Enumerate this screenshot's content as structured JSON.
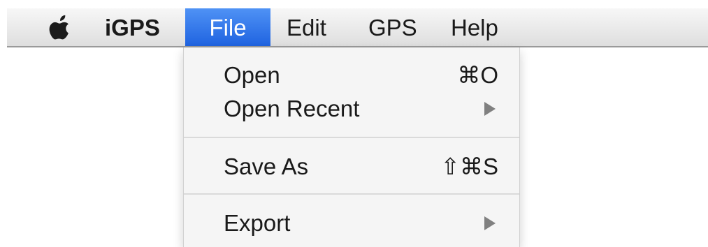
{
  "menubar": {
    "apple_icon": "apple-icon",
    "items": [
      {
        "label": "iGPS"
      },
      {
        "label": "File"
      },
      {
        "label": "Edit"
      },
      {
        "label": "GPS"
      },
      {
        "label": "Help"
      }
    ],
    "active_item": "File"
  },
  "file_menu": {
    "items": [
      {
        "label": "Open",
        "shortcut": "⌘O"
      },
      {
        "label": "Open Recent",
        "submenu_icon": "chevron-right-icon"
      },
      {
        "label": "Save As",
        "shortcut": "⇧⌘S"
      },
      {
        "label": "Export",
        "submenu_icon": "chevron-right-icon"
      }
    ]
  },
  "colors": {
    "active_menu": "#2b6de6",
    "menubar": "#e6e6e6",
    "dropdown": "#f5f5f5"
  }
}
